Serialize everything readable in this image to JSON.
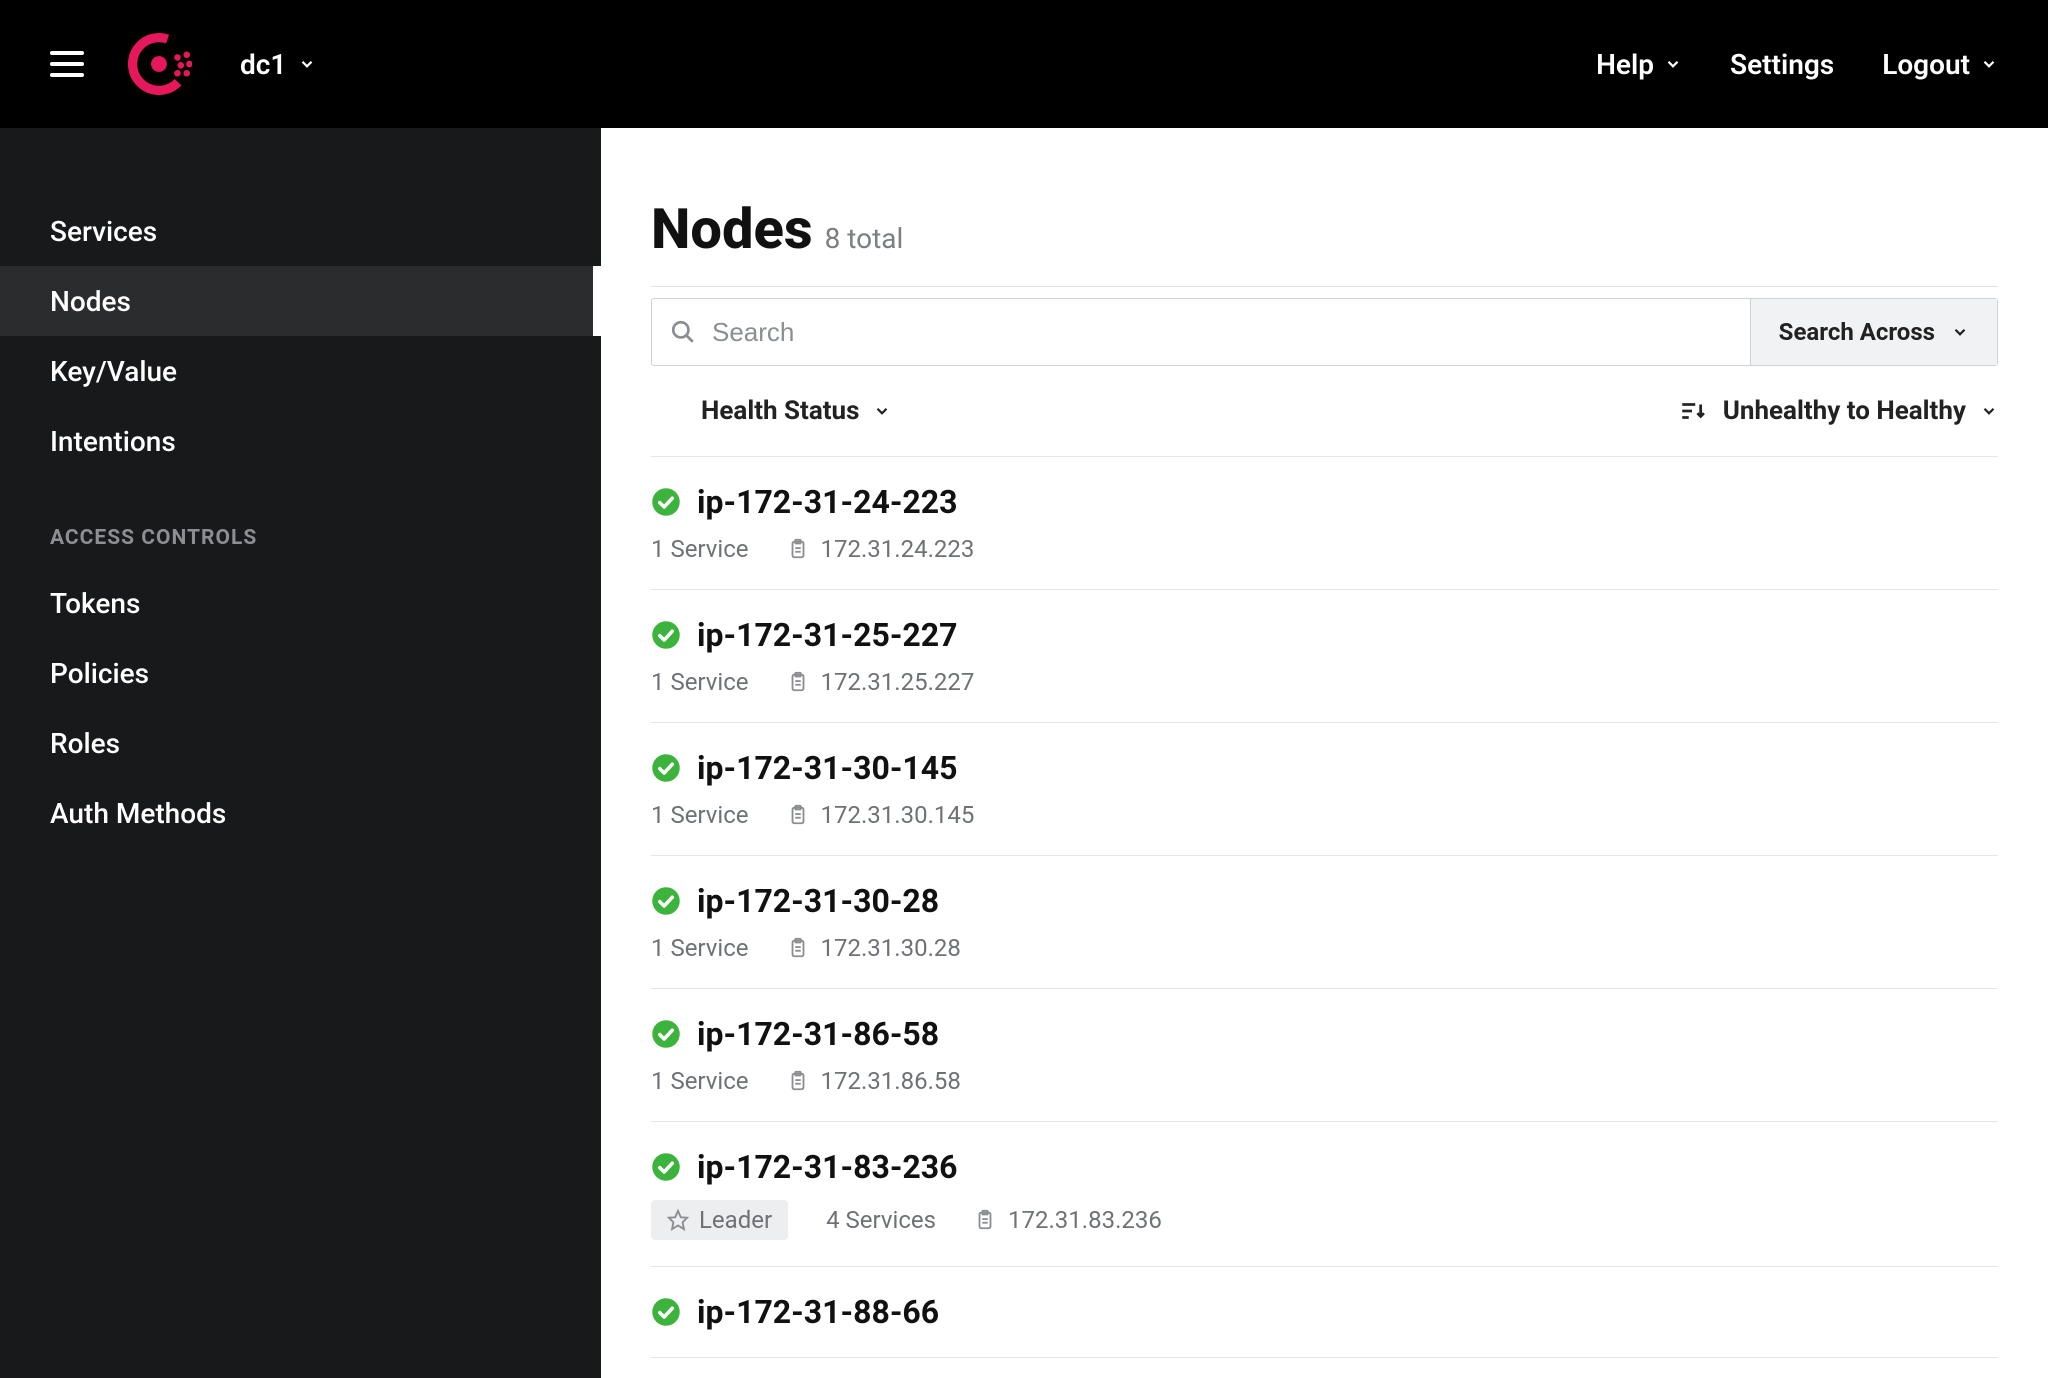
{
  "header": {
    "datacenter": "dc1",
    "help": "Help",
    "settings": "Settings",
    "logout": "Logout"
  },
  "sidebar": {
    "main": [
      {
        "label": "Services",
        "active": false
      },
      {
        "label": "Nodes",
        "active": true
      },
      {
        "label": "Key/Value",
        "active": false
      },
      {
        "label": "Intentions",
        "active": false
      }
    ],
    "section_header": "ACCESS CONTROLS",
    "access": [
      {
        "label": "Tokens"
      },
      {
        "label": "Policies"
      },
      {
        "label": "Roles"
      },
      {
        "label": "Auth Methods"
      }
    ]
  },
  "page": {
    "title": "Nodes",
    "subtitle": "8 total",
    "search_placeholder": "Search",
    "search_across": "Search Across",
    "filter_health": "Health Status",
    "sort_label": "Unhealthy to Healthy"
  },
  "nodes": [
    {
      "name": "ip-172-31-24-223",
      "services": "1 Service",
      "ip": "172.31.24.223",
      "leader": false
    },
    {
      "name": "ip-172-31-25-227",
      "services": "1 Service",
      "ip": "172.31.25.227",
      "leader": false
    },
    {
      "name": "ip-172-31-30-145",
      "services": "1 Service",
      "ip": "172.31.30.145",
      "leader": false
    },
    {
      "name": "ip-172-31-30-28",
      "services": "1 Service",
      "ip": "172.31.30.28",
      "leader": false
    },
    {
      "name": "ip-172-31-86-58",
      "services": "1 Service",
      "ip": "172.31.86.58",
      "leader": false
    },
    {
      "name": "ip-172-31-83-236",
      "services": "4 Services",
      "ip": "172.31.83.236",
      "leader": true
    },
    {
      "name": "ip-172-31-88-66",
      "services": "",
      "ip": "",
      "leader": false
    }
  ],
  "leader_label": "Leader"
}
